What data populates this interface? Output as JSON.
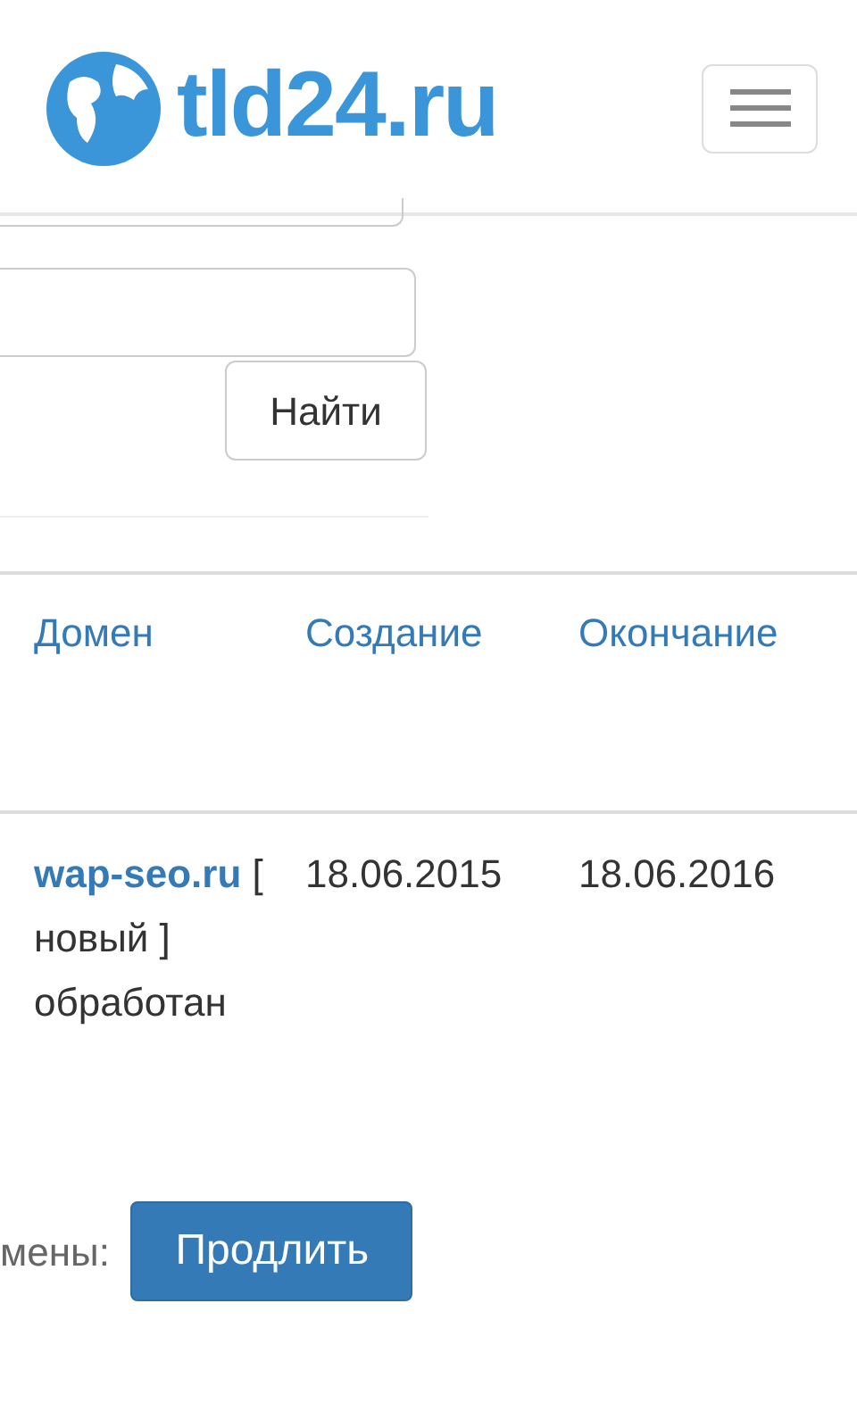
{
  "header": {
    "logo_text": "tld24.ru"
  },
  "search_form": {
    "button": "Найти"
  },
  "table": {
    "columns": [
      "Домен",
      "Создание",
      "Окончание"
    ],
    "rows": [
      {
        "domain": "wap-seo.ru",
        "status": "[ новый ] обработан",
        "created": "18.06.2015",
        "expires": "18.06.2016"
      }
    ]
  },
  "footer": {
    "label": "мены:",
    "button": "Продлить"
  }
}
